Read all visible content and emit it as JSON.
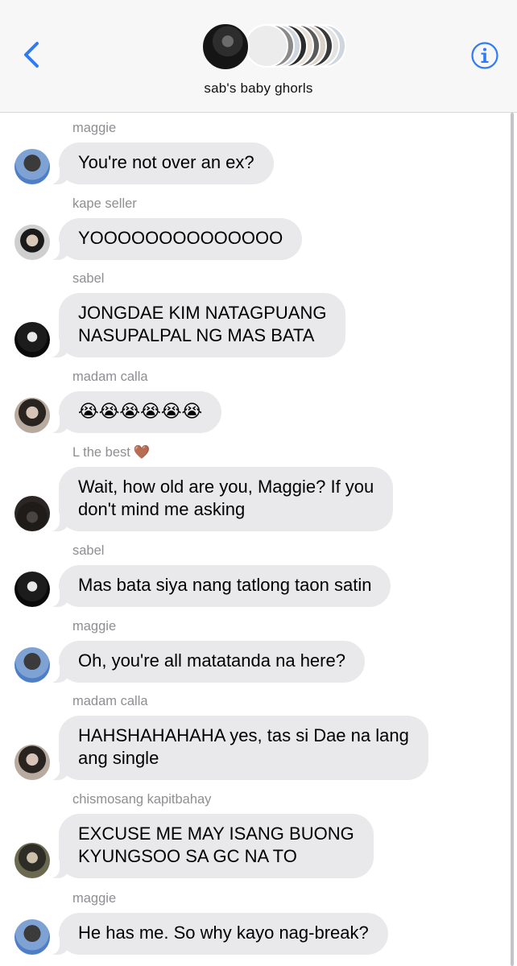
{
  "header": {
    "group_name": "sab's baby ghorls",
    "back_icon": "chevron-left-icon",
    "info_icon": "info-circle-icon",
    "accent_color": "#2f7bf6"
  },
  "messages": [
    {
      "sender": "maggie",
      "text": "You're not over an ex?",
      "avatar": "maggie"
    },
    {
      "sender": "kape seller",
      "text": "YOOOOOOOOOOOOOO",
      "avatar": "kape"
    },
    {
      "sender": "sabel",
      "text": "JONGDAE KIM NATAGPUANG\nNASUPALPAL NG MAS BATA",
      "avatar": "sabel"
    },
    {
      "sender": "madam calla",
      "text": "😭😭😭😭😭😭",
      "avatar": "calla"
    },
    {
      "sender": "L the best",
      "sender_emoji": "🤎",
      "text": "Wait, how old are you, Maggie? If you\ndon't mind me asking",
      "avatar": "lbest"
    },
    {
      "sender": "sabel",
      "text": "Mas bata siya nang tatlong taon satin",
      "avatar": "sabel"
    },
    {
      "sender": "maggie",
      "text": "Oh, you're all matatanda na here?",
      "avatar": "maggie"
    },
    {
      "sender": "madam calla",
      "text": "HAHSHAHAHAHA yes, tas si Dae na lang\nang single",
      "avatar": "calla"
    },
    {
      "sender": "chismosang kapitbahay",
      "text": "EXCUSE ME MAY ISANG BUONG\nKYUNGSOO SA GC NA TO",
      "avatar": "chismosa"
    },
    {
      "sender": "maggie",
      "text": "He has me. So why kayo nag-break?",
      "avatar": "maggie"
    }
  ],
  "bubble_color": "#e9e9eb",
  "sender_color": "#8e8e93"
}
